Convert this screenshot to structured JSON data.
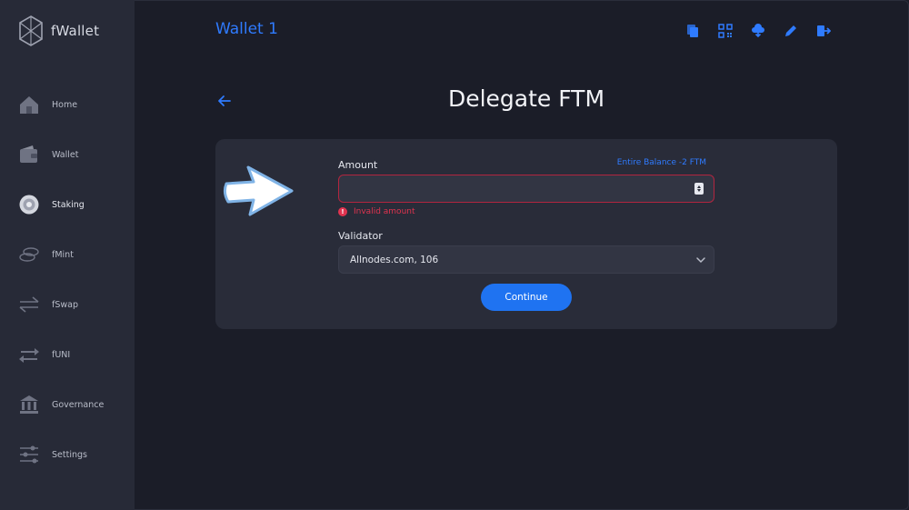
{
  "app": {
    "name": "fWallet"
  },
  "sidebar": {
    "items": [
      {
        "label": "Home",
        "icon": "home-icon"
      },
      {
        "label": "Wallet",
        "icon": "wallet-icon"
      },
      {
        "label": "Staking",
        "icon": "staking-icon",
        "active": true
      },
      {
        "label": "fMint",
        "icon": "coins-icon"
      },
      {
        "label": "fSwap",
        "icon": "swap-icon"
      },
      {
        "label": "fUNI",
        "icon": "transfer-icon"
      },
      {
        "label": "Governance",
        "icon": "bank-icon"
      },
      {
        "label": "Settings",
        "icon": "sliders-icon"
      }
    ]
  },
  "header": {
    "wallet_title": "Wallet 1",
    "toolbar_icons": [
      "copy-icon",
      "qr-code-icon",
      "cloud-download-icon",
      "edit-pencil-icon",
      "logout-icon"
    ]
  },
  "page": {
    "title": "Delegate FTM"
  },
  "form": {
    "amount_label": "Amount",
    "entire_balance_link": "Entire Balance -2 FTM",
    "amount_value": "",
    "amount_error": "Invalid amount",
    "validator_label": "Validator",
    "validator_value": "Allnodes.com, 106",
    "continue_label": "Continue"
  },
  "colors": {
    "accent": "#2f7bff",
    "button": "#1f73f1",
    "error": "#e0334f",
    "background": "#1b1d28",
    "sidebar": "#272a37",
    "card": "#292c39"
  }
}
